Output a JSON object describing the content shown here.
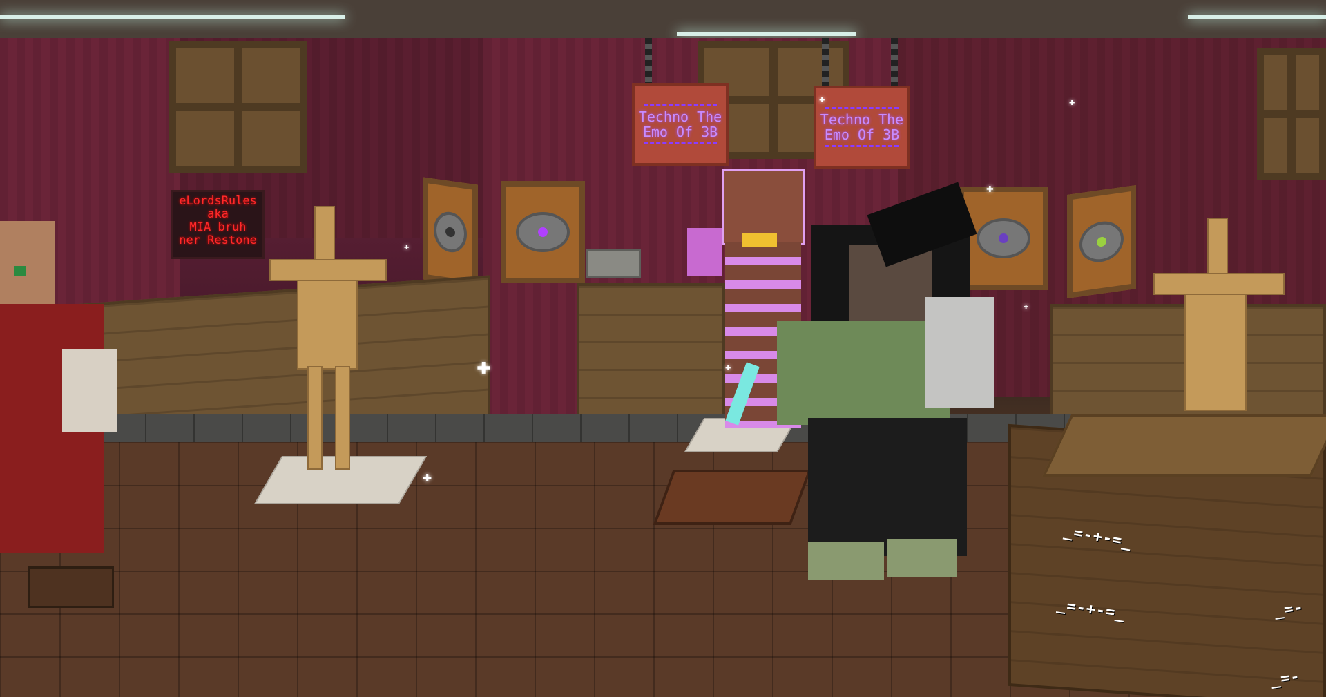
{
  "scene": {
    "signs_hanging": [
      {
        "lines": [
          "Techno The",
          "Emo Of 3B"
        ]
      },
      {
        "lines": [
          "Techno The",
          "Emo Of 3B"
        ]
      }
    ],
    "red_sign": {
      "lines": [
        "eLordsRules",
        "aka",
        "MIA bruh",
        "ner Restone"
      ]
    },
    "chest_labels": [
      "_=-+-=_",
      "_=-+-=_",
      "_=-",
      "_=-"
    ],
    "colors": {
      "wall": "#6a2438",
      "floor": "#5a3a28",
      "sign_text": "#c78cff",
      "red_text": "#ff2a2a"
    }
  }
}
